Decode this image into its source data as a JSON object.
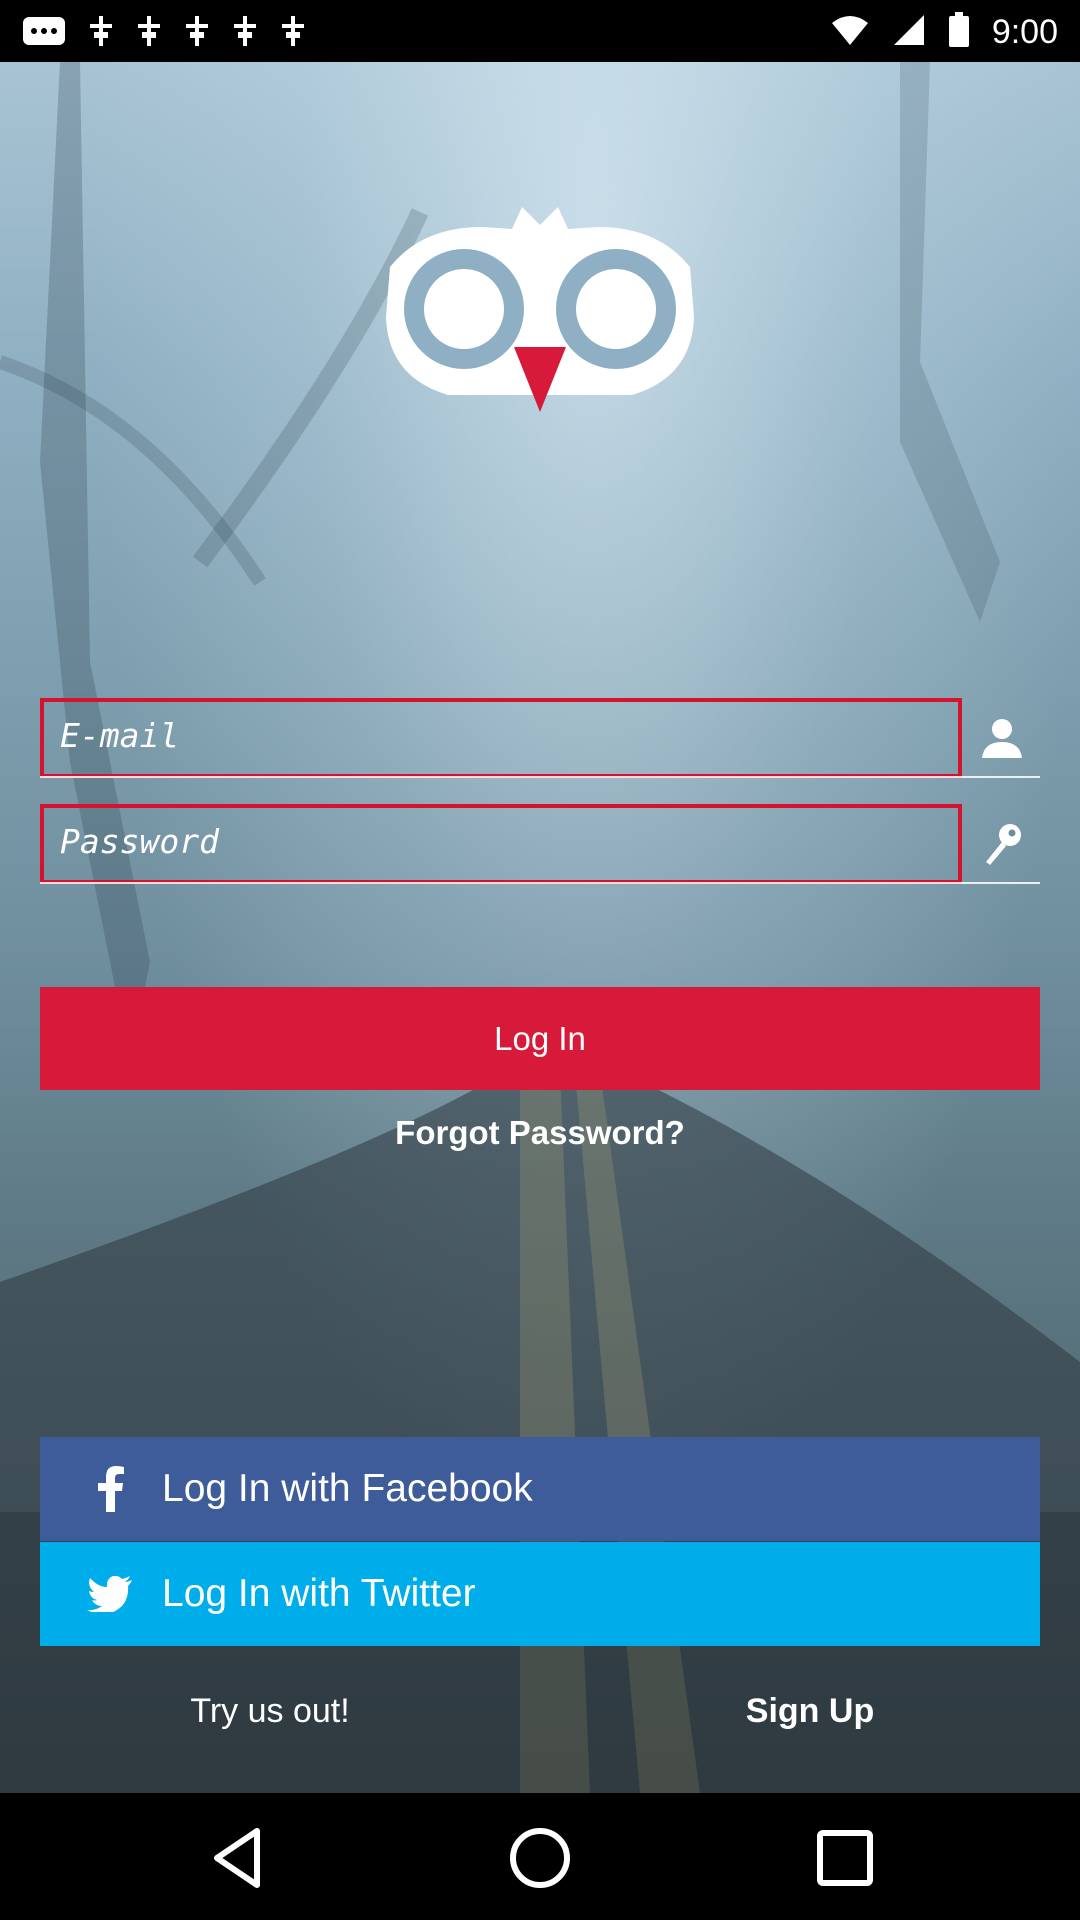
{
  "status_bar": {
    "time": "9:00",
    "left_icons": [
      "more-icon",
      "notification-icon",
      "notification-icon",
      "notification-icon",
      "notification-icon",
      "notification-icon"
    ],
    "right_icons": [
      "wifi-icon",
      "signal-icon",
      "battery-icon"
    ]
  },
  "login": {
    "email_placeholder": "E-mail",
    "password_placeholder": "Password",
    "login_label": "Log In",
    "forgot_label": "Forgot Password?"
  },
  "social": {
    "facebook_label": "Log In with Facebook",
    "twitter_label": "Log In with Twitter"
  },
  "footer": {
    "try_label": "Try us out!",
    "signup_label": "Sign Up"
  },
  "colors": {
    "accent_red": "#d81a3a",
    "facebook_blue": "#3e5b9a",
    "twitter_blue": "#00adeb"
  }
}
